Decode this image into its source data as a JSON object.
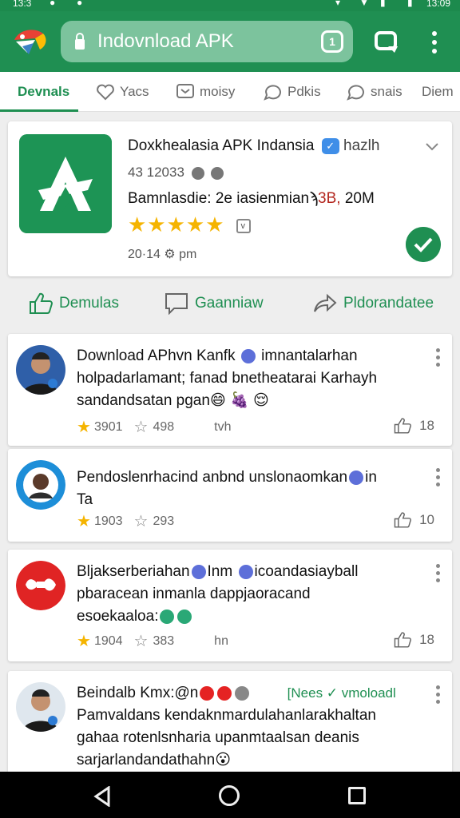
{
  "status_bar": {
    "time_left": "13:3",
    "time_right": "13:09"
  },
  "browser": {
    "address_title": "Indovnload APK"
  },
  "tabs": [
    {
      "label": "Devnals",
      "active": true
    },
    {
      "label": "Yacs"
    },
    {
      "label": "moisy"
    },
    {
      "label": "Pdkis"
    },
    {
      "label": "snais"
    },
    {
      "label": "Diem"
    }
  ],
  "app": {
    "name": "Doxkhealasia APK Indansia",
    "name_tail": "hazlh",
    "badge": "✓",
    "meta1": "43 12033",
    "meta2_prefix": "Bamnlasdie: 2e iasienmianϡ",
    "meta2_red": "3B,",
    "meta2_suffix": " 20M",
    "stars": "★★★★★",
    "verified_badge": "v",
    "meta3": "20·14 ⚙ pm"
  },
  "actions": [
    {
      "label": "Demulas",
      "icon": "thumbs-up-icon"
    },
    {
      "label": "Gaanniaw",
      "icon": "comment-icon"
    },
    {
      "label": "Pldorandatee",
      "icon": "share-icon"
    }
  ],
  "comments": [
    {
      "lines": [
        "Download APhvn Kanfk",
        "holpadarlamant; fanad bnetheatarai Karhayh",
        "sandandsatan pgan"
      ],
      "line1_suffix": "imnantalarhan",
      "line3_suffix": "😄 🍇 😌",
      "rating": "3901",
      "count": "498",
      "extra": "tvh",
      "likes": "18"
    },
    {
      "lines": [
        "Pendoslenrhacind anbnd unslonaomkan",
        "Ta"
      ],
      "line1_suffix": "in",
      "rating": "1903",
      "count": "293",
      "likes": "10"
    },
    {
      "lines": [
        "Bljakserberiahan",
        "pbaracean inmanla  dappjaoracand",
        "esoekaaloa:"
      ],
      "line1_suffix": "Inm",
      "line1_suffix2": "icoandasiayball",
      "rating": "1904",
      "count": "383",
      "extra": "hn",
      "likes": "18"
    },
    {
      "lines": [
        "Beindalb Kmx:@n",
        "Pamvaldans kendaknmardulahanlarakhaltan",
        "gahaa rotenlsnharia upanmtaalsan deanis",
        "sarjarlandandathahn"
      ],
      "line1_suffix": "[Nees ✓ vmoloadl",
      "line4_suffix": "😮"
    }
  ]
}
